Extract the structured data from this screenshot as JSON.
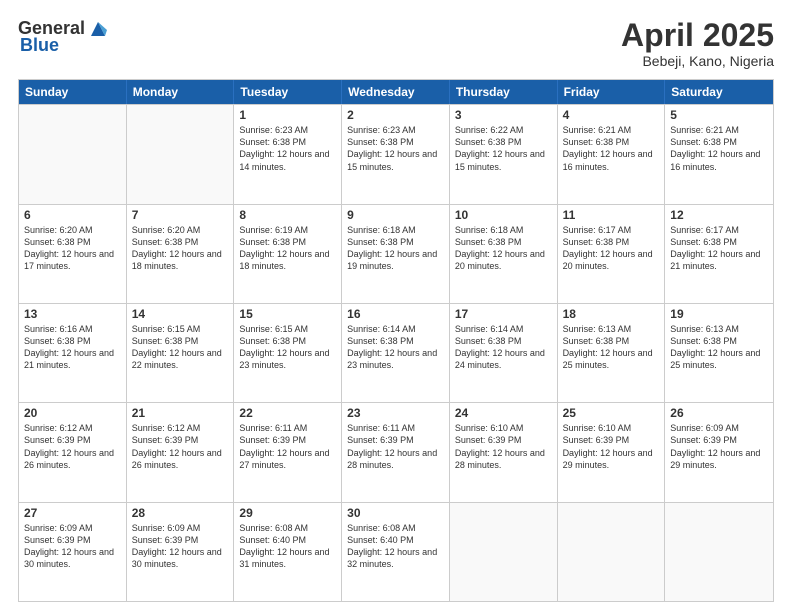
{
  "header": {
    "logo_general": "General",
    "logo_blue": "Blue",
    "title": "April 2025",
    "location": "Bebeji, Kano, Nigeria"
  },
  "days_of_week": [
    "Sunday",
    "Monday",
    "Tuesday",
    "Wednesday",
    "Thursday",
    "Friday",
    "Saturday"
  ],
  "weeks": [
    [
      {
        "day": "",
        "info": ""
      },
      {
        "day": "",
        "info": ""
      },
      {
        "day": "1",
        "info": "Sunrise: 6:23 AM\nSunset: 6:38 PM\nDaylight: 12 hours and 14 minutes."
      },
      {
        "day": "2",
        "info": "Sunrise: 6:23 AM\nSunset: 6:38 PM\nDaylight: 12 hours and 15 minutes."
      },
      {
        "day": "3",
        "info": "Sunrise: 6:22 AM\nSunset: 6:38 PM\nDaylight: 12 hours and 15 minutes."
      },
      {
        "day": "4",
        "info": "Sunrise: 6:21 AM\nSunset: 6:38 PM\nDaylight: 12 hours and 16 minutes."
      },
      {
        "day": "5",
        "info": "Sunrise: 6:21 AM\nSunset: 6:38 PM\nDaylight: 12 hours and 16 minutes."
      }
    ],
    [
      {
        "day": "6",
        "info": "Sunrise: 6:20 AM\nSunset: 6:38 PM\nDaylight: 12 hours and 17 minutes."
      },
      {
        "day": "7",
        "info": "Sunrise: 6:20 AM\nSunset: 6:38 PM\nDaylight: 12 hours and 18 minutes."
      },
      {
        "day": "8",
        "info": "Sunrise: 6:19 AM\nSunset: 6:38 PM\nDaylight: 12 hours and 18 minutes."
      },
      {
        "day": "9",
        "info": "Sunrise: 6:18 AM\nSunset: 6:38 PM\nDaylight: 12 hours and 19 minutes."
      },
      {
        "day": "10",
        "info": "Sunrise: 6:18 AM\nSunset: 6:38 PM\nDaylight: 12 hours and 20 minutes."
      },
      {
        "day": "11",
        "info": "Sunrise: 6:17 AM\nSunset: 6:38 PM\nDaylight: 12 hours and 20 minutes."
      },
      {
        "day": "12",
        "info": "Sunrise: 6:17 AM\nSunset: 6:38 PM\nDaylight: 12 hours and 21 minutes."
      }
    ],
    [
      {
        "day": "13",
        "info": "Sunrise: 6:16 AM\nSunset: 6:38 PM\nDaylight: 12 hours and 21 minutes."
      },
      {
        "day": "14",
        "info": "Sunrise: 6:15 AM\nSunset: 6:38 PM\nDaylight: 12 hours and 22 minutes."
      },
      {
        "day": "15",
        "info": "Sunrise: 6:15 AM\nSunset: 6:38 PM\nDaylight: 12 hours and 23 minutes."
      },
      {
        "day": "16",
        "info": "Sunrise: 6:14 AM\nSunset: 6:38 PM\nDaylight: 12 hours and 23 minutes."
      },
      {
        "day": "17",
        "info": "Sunrise: 6:14 AM\nSunset: 6:38 PM\nDaylight: 12 hours and 24 minutes."
      },
      {
        "day": "18",
        "info": "Sunrise: 6:13 AM\nSunset: 6:38 PM\nDaylight: 12 hours and 25 minutes."
      },
      {
        "day": "19",
        "info": "Sunrise: 6:13 AM\nSunset: 6:38 PM\nDaylight: 12 hours and 25 minutes."
      }
    ],
    [
      {
        "day": "20",
        "info": "Sunrise: 6:12 AM\nSunset: 6:39 PM\nDaylight: 12 hours and 26 minutes."
      },
      {
        "day": "21",
        "info": "Sunrise: 6:12 AM\nSunset: 6:39 PM\nDaylight: 12 hours and 26 minutes."
      },
      {
        "day": "22",
        "info": "Sunrise: 6:11 AM\nSunset: 6:39 PM\nDaylight: 12 hours and 27 minutes."
      },
      {
        "day": "23",
        "info": "Sunrise: 6:11 AM\nSunset: 6:39 PM\nDaylight: 12 hours and 28 minutes."
      },
      {
        "day": "24",
        "info": "Sunrise: 6:10 AM\nSunset: 6:39 PM\nDaylight: 12 hours and 28 minutes."
      },
      {
        "day": "25",
        "info": "Sunrise: 6:10 AM\nSunset: 6:39 PM\nDaylight: 12 hours and 29 minutes."
      },
      {
        "day": "26",
        "info": "Sunrise: 6:09 AM\nSunset: 6:39 PM\nDaylight: 12 hours and 29 minutes."
      }
    ],
    [
      {
        "day": "27",
        "info": "Sunrise: 6:09 AM\nSunset: 6:39 PM\nDaylight: 12 hours and 30 minutes."
      },
      {
        "day": "28",
        "info": "Sunrise: 6:09 AM\nSunset: 6:39 PM\nDaylight: 12 hours and 30 minutes."
      },
      {
        "day": "29",
        "info": "Sunrise: 6:08 AM\nSunset: 6:40 PM\nDaylight: 12 hours and 31 minutes."
      },
      {
        "day": "30",
        "info": "Sunrise: 6:08 AM\nSunset: 6:40 PM\nDaylight: 12 hours and 32 minutes."
      },
      {
        "day": "",
        "info": ""
      },
      {
        "day": "",
        "info": ""
      },
      {
        "day": "",
        "info": ""
      }
    ]
  ]
}
